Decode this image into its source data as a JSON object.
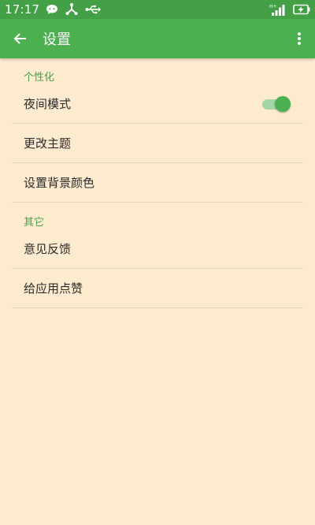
{
  "status_bar": {
    "time": "17:17",
    "left_icons": [
      "chat-bubble-icon",
      "share-network-icon",
      "usb-icon"
    ],
    "right_icons": [
      "signal-icon",
      "battery-charging-icon"
    ],
    "network_label": "H+"
  },
  "toolbar": {
    "title": "设置",
    "back_icon": "arrow-left-icon",
    "overflow_icon": "more-vertical-icon"
  },
  "sections": [
    {
      "header": "个性化",
      "items": [
        {
          "label": "夜间模式",
          "toggle": true,
          "toggle_on": true
        },
        {
          "label": "更改主题"
        },
        {
          "label": "设置背景颜色"
        }
      ]
    },
    {
      "header": "其它",
      "items": [
        {
          "label": "意见反馈"
        },
        {
          "label": "给应用点赞"
        }
      ]
    }
  ],
  "colors": {
    "primary": "#4CAF50",
    "status_bar": "#43A047",
    "background": "#FDEBCF",
    "accent_text": "#43A047",
    "divider": "#E4D4BB"
  }
}
